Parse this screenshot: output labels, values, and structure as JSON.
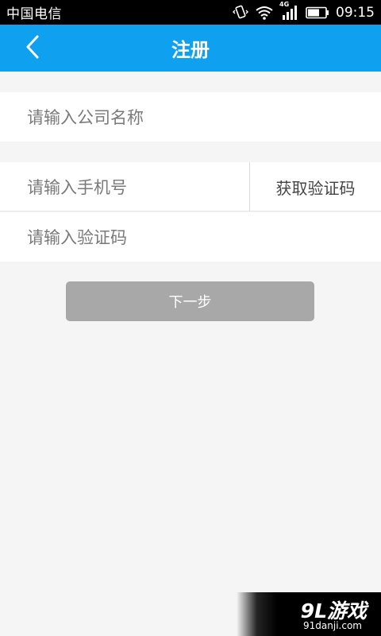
{
  "status_bar": {
    "carrier": "中国电信",
    "network_badge": "4G",
    "time": "09:15",
    "icons": [
      "vibrate-icon",
      "wifi-icon",
      "signal-icon",
      "battery-icon"
    ]
  },
  "header": {
    "title": "注册",
    "back_icon": "chevron-left-icon",
    "color": "#0fa1f0"
  },
  "form": {
    "company_placeholder": "请输入公司名称",
    "phone_placeholder": "请输入手机号",
    "get_code_label": "获取验证码",
    "code_placeholder": "请输入验证码",
    "next_label": "下一步"
  },
  "watermark": {
    "main": "9L游戏",
    "sub": "91danji.com"
  }
}
